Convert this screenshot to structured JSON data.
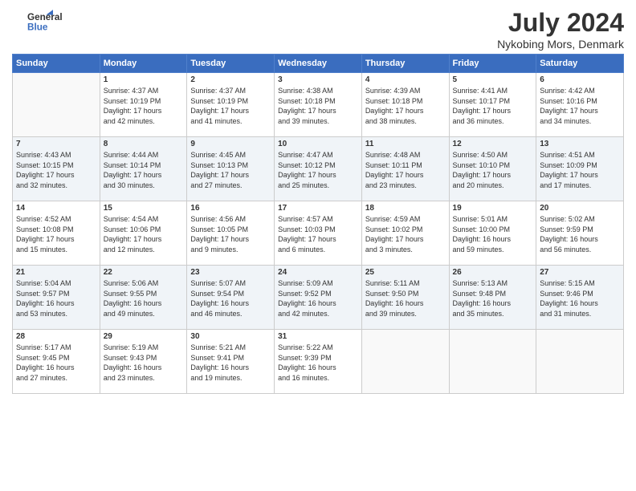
{
  "header": {
    "logo_line1": "General",
    "logo_line2": "Blue",
    "month": "July 2024",
    "location": "Nykobing Mors, Denmark"
  },
  "days_of_week": [
    "Sunday",
    "Monday",
    "Tuesday",
    "Wednesday",
    "Thursday",
    "Friday",
    "Saturday"
  ],
  "weeks": [
    [
      {
        "day": "",
        "info": ""
      },
      {
        "day": "1",
        "info": "Sunrise: 4:37 AM\nSunset: 10:19 PM\nDaylight: 17 hours\nand 42 minutes."
      },
      {
        "day": "2",
        "info": "Sunrise: 4:37 AM\nSunset: 10:19 PM\nDaylight: 17 hours\nand 41 minutes."
      },
      {
        "day": "3",
        "info": "Sunrise: 4:38 AM\nSunset: 10:18 PM\nDaylight: 17 hours\nand 39 minutes."
      },
      {
        "day": "4",
        "info": "Sunrise: 4:39 AM\nSunset: 10:18 PM\nDaylight: 17 hours\nand 38 minutes."
      },
      {
        "day": "5",
        "info": "Sunrise: 4:41 AM\nSunset: 10:17 PM\nDaylight: 17 hours\nand 36 minutes."
      },
      {
        "day": "6",
        "info": "Sunrise: 4:42 AM\nSunset: 10:16 PM\nDaylight: 17 hours\nand 34 minutes."
      }
    ],
    [
      {
        "day": "7",
        "info": "Sunrise: 4:43 AM\nSunset: 10:15 PM\nDaylight: 17 hours\nand 32 minutes."
      },
      {
        "day": "8",
        "info": "Sunrise: 4:44 AM\nSunset: 10:14 PM\nDaylight: 17 hours\nand 30 minutes."
      },
      {
        "day": "9",
        "info": "Sunrise: 4:45 AM\nSunset: 10:13 PM\nDaylight: 17 hours\nand 27 minutes."
      },
      {
        "day": "10",
        "info": "Sunrise: 4:47 AM\nSunset: 10:12 PM\nDaylight: 17 hours\nand 25 minutes."
      },
      {
        "day": "11",
        "info": "Sunrise: 4:48 AM\nSunset: 10:11 PM\nDaylight: 17 hours\nand 23 minutes."
      },
      {
        "day": "12",
        "info": "Sunrise: 4:50 AM\nSunset: 10:10 PM\nDaylight: 17 hours\nand 20 minutes."
      },
      {
        "day": "13",
        "info": "Sunrise: 4:51 AM\nSunset: 10:09 PM\nDaylight: 17 hours\nand 17 minutes."
      }
    ],
    [
      {
        "day": "14",
        "info": "Sunrise: 4:52 AM\nSunset: 10:08 PM\nDaylight: 17 hours\nand 15 minutes."
      },
      {
        "day": "15",
        "info": "Sunrise: 4:54 AM\nSunset: 10:06 PM\nDaylight: 17 hours\nand 12 minutes."
      },
      {
        "day": "16",
        "info": "Sunrise: 4:56 AM\nSunset: 10:05 PM\nDaylight: 17 hours\nand 9 minutes."
      },
      {
        "day": "17",
        "info": "Sunrise: 4:57 AM\nSunset: 10:03 PM\nDaylight: 17 hours\nand 6 minutes."
      },
      {
        "day": "18",
        "info": "Sunrise: 4:59 AM\nSunset: 10:02 PM\nDaylight: 17 hours\nand 3 minutes."
      },
      {
        "day": "19",
        "info": "Sunrise: 5:01 AM\nSunset: 10:00 PM\nDaylight: 16 hours\nand 59 minutes."
      },
      {
        "day": "20",
        "info": "Sunrise: 5:02 AM\nSunset: 9:59 PM\nDaylight: 16 hours\nand 56 minutes."
      }
    ],
    [
      {
        "day": "21",
        "info": "Sunrise: 5:04 AM\nSunset: 9:57 PM\nDaylight: 16 hours\nand 53 minutes."
      },
      {
        "day": "22",
        "info": "Sunrise: 5:06 AM\nSunset: 9:55 PM\nDaylight: 16 hours\nand 49 minutes."
      },
      {
        "day": "23",
        "info": "Sunrise: 5:07 AM\nSunset: 9:54 PM\nDaylight: 16 hours\nand 46 minutes."
      },
      {
        "day": "24",
        "info": "Sunrise: 5:09 AM\nSunset: 9:52 PM\nDaylight: 16 hours\nand 42 minutes."
      },
      {
        "day": "25",
        "info": "Sunrise: 5:11 AM\nSunset: 9:50 PM\nDaylight: 16 hours\nand 39 minutes."
      },
      {
        "day": "26",
        "info": "Sunrise: 5:13 AM\nSunset: 9:48 PM\nDaylight: 16 hours\nand 35 minutes."
      },
      {
        "day": "27",
        "info": "Sunrise: 5:15 AM\nSunset: 9:46 PM\nDaylight: 16 hours\nand 31 minutes."
      }
    ],
    [
      {
        "day": "28",
        "info": "Sunrise: 5:17 AM\nSunset: 9:45 PM\nDaylight: 16 hours\nand 27 minutes."
      },
      {
        "day": "29",
        "info": "Sunrise: 5:19 AM\nSunset: 9:43 PM\nDaylight: 16 hours\nand 23 minutes."
      },
      {
        "day": "30",
        "info": "Sunrise: 5:21 AM\nSunset: 9:41 PM\nDaylight: 16 hours\nand 19 minutes."
      },
      {
        "day": "31",
        "info": "Sunrise: 5:22 AM\nSunset: 9:39 PM\nDaylight: 16 hours\nand 16 minutes."
      },
      {
        "day": "",
        "info": ""
      },
      {
        "day": "",
        "info": ""
      },
      {
        "day": "",
        "info": ""
      }
    ]
  ]
}
